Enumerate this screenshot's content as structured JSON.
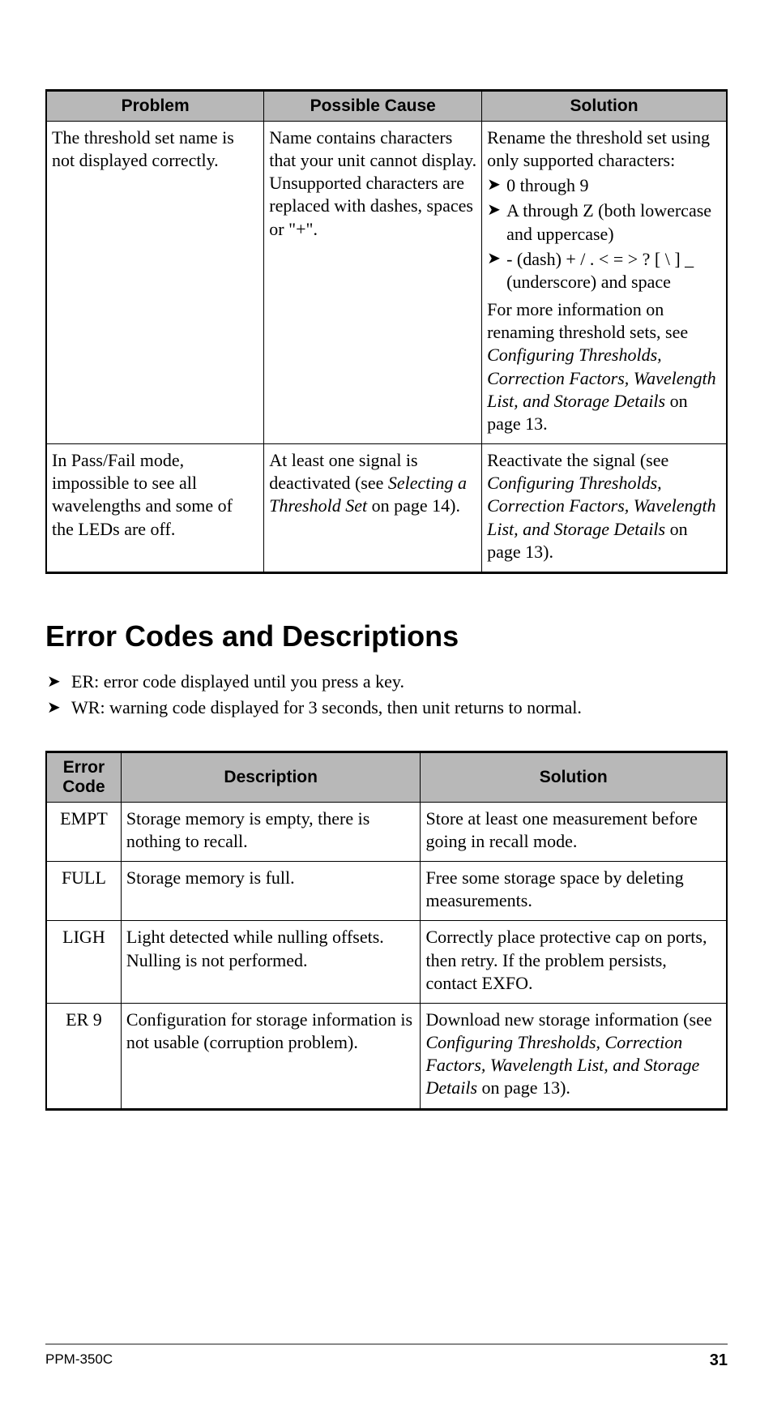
{
  "table1": {
    "headers": {
      "problem": "Problem",
      "cause": "Possible Cause",
      "solution": "Solution"
    },
    "rows": [
      {
        "problem": "The threshold set name is not displayed correctly.",
        "cause": "Name contains characters that your unit cannot display. Unsupported characters are replaced with dashes, spaces or \"+\".",
        "solution_intro": "Rename the threshold set using only supported characters:",
        "bullets": [
          "0 through 9",
          "A through Z (both lowercase and uppercase)",
          "- (dash) + / . < = > ? [ \\ ] _ (underscore) and space"
        ],
        "solution_outro_pre": "For more information on renaming threshold sets, see ",
        "solution_outro_italic": "Configuring Thresholds, Correction Factors, Wavelength List, and Storage Details",
        "solution_outro_post": " on page 13."
      },
      {
        "problem": "In Pass/Fail mode, impossible to see all wavelengths and some of the LEDs are off.",
        "cause_pre": "At least one signal is deactivated (see ",
        "cause_italic": "Selecting a Threshold Set",
        "cause_post": " on page 14).",
        "solution_pre": "Reactivate the signal (see ",
        "solution_italic": "Configuring Thresholds, Correction Factors, Wavelength List, and Storage Details",
        "solution_post": " on page 13)."
      }
    ]
  },
  "section_title": "Error Codes and Descriptions",
  "intro_bullets": [
    "ER: error code displayed until you press a key.",
    "WR: warning code displayed for 3 seconds, then unit returns to normal."
  ],
  "table2": {
    "headers": {
      "code": "Error Code",
      "desc": "Description",
      "solution": "Solution"
    },
    "rows": [
      {
        "code": "EMPT",
        "desc": "Storage memory is empty, there is nothing to recall.",
        "solution": "Store at least one measurement before going in recall mode."
      },
      {
        "code": "FULL",
        "desc": "Storage memory is full.",
        "solution": "Free some storage space by deleting measurements."
      },
      {
        "code": "LIGH",
        "desc": "Light detected while nulling offsets. Nulling is not performed.",
        "solution": "Correctly place protective cap on ports, then retry. If the problem persists, contact EXFO."
      },
      {
        "code": "ER 9",
        "desc": "Configuration for storage information is not usable (corruption problem).",
        "solution_pre": "Download new storage information (see ",
        "solution_italic": "Configuring Thresholds, Correction Factors, Wavelength List, and Storage Details",
        "solution_post": " on page 13)."
      }
    ]
  },
  "footer": {
    "product": "PPM-350C",
    "page": "31"
  }
}
